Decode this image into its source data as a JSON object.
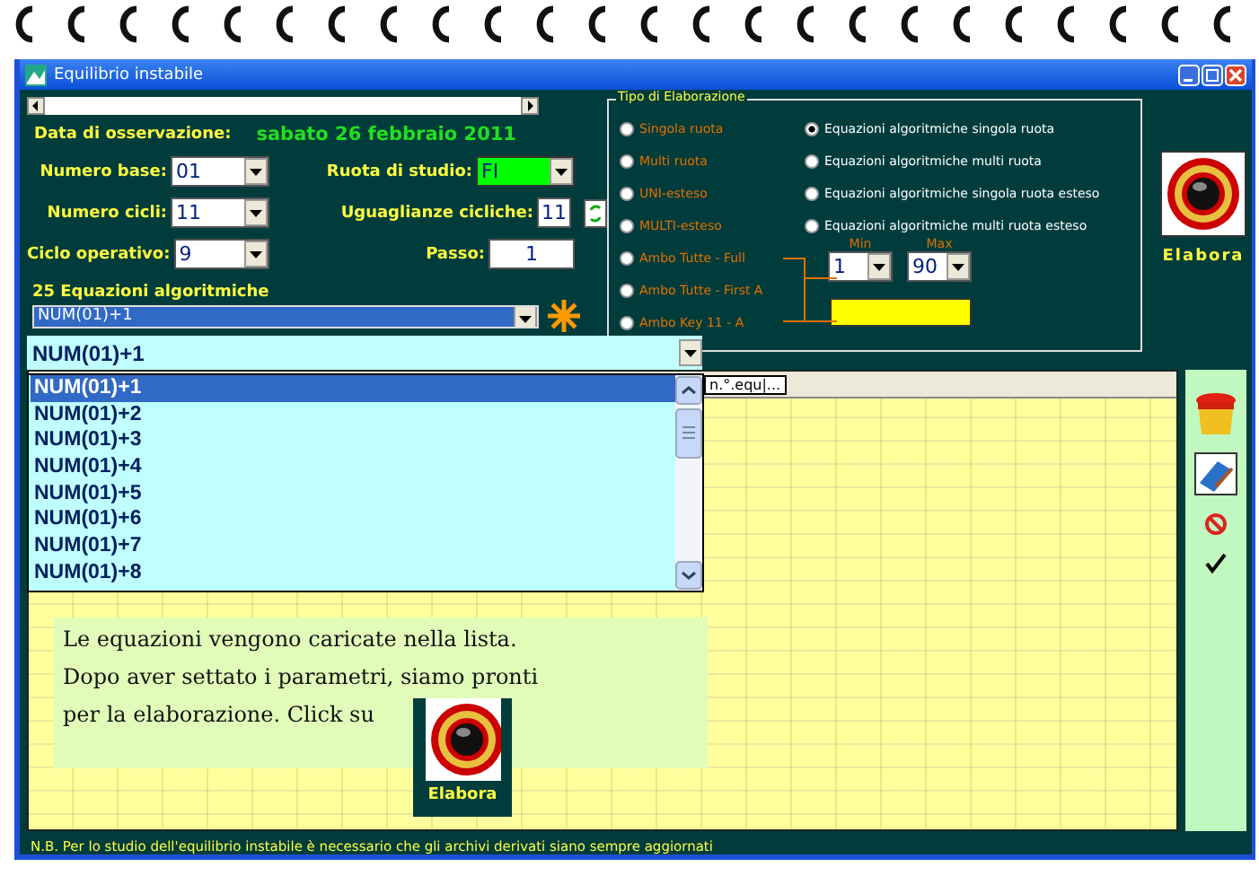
{
  "window": {
    "title": "Equilibrio instabile"
  },
  "date": {
    "label": "Data di osservazione:",
    "value": "sabato 26 febbraio 2011"
  },
  "fields": [
    {
      "label": "Numero base:",
      "value": "01",
      "kind": "combo",
      "highlight": false
    },
    {
      "label": "Ruota di studio:",
      "value": "FI",
      "kind": "combo",
      "highlight": true
    },
    {
      "label": "Numero cicli:",
      "value": "11",
      "kind": "combo",
      "highlight": false
    },
    {
      "label": "Uguaglianze cicliche:",
      "value": "11",
      "kind": "counter",
      "highlight": false
    },
    {
      "label": "Ciclo operativo:",
      "value": "9",
      "kind": "combo",
      "highlight": false
    },
    {
      "label": "Passo:",
      "value": "1",
      "kind": "text",
      "highlight": false
    }
  ],
  "equations": {
    "label": "25 Equazioni algoritmiche",
    "value": "NUM(01)+1",
    "edit_value": "NUM(01)+1",
    "options": [
      {
        "label": "NUM(01)+1",
        "selected": true
      },
      {
        "label": "NUM(01)+2",
        "selected": false
      },
      {
        "label": "NUM(01)+3",
        "selected": false
      },
      {
        "label": "NUM(01)+4",
        "selected": false
      },
      {
        "label": "NUM(01)+5",
        "selected": false
      },
      {
        "label": "NUM(01)+6",
        "selected": false
      },
      {
        "label": "NUM(01)+7",
        "selected": false
      },
      {
        "label": "NUM(01)+8",
        "selected": false
      }
    ]
  },
  "processing_type": {
    "title": "Tipo di Elaborazione",
    "left_options": [
      {
        "label": "Singola ruota",
        "selected": false
      },
      {
        "label": "Multi ruota",
        "selected": false
      },
      {
        "label": "UNI-esteso",
        "selected": false
      },
      {
        "label": "MULTI-esteso",
        "selected": false
      },
      {
        "label": "Ambo Tutte - Full",
        "selected": false
      },
      {
        "label": "Ambo Tutte - First A",
        "selected": false
      },
      {
        "label": "Ambo Key 11 -  A",
        "selected": false
      }
    ],
    "right_options": [
      {
        "label": "Equazioni algoritmiche singola ruota",
        "selected": true
      },
      {
        "label": "Equazioni algoritmiche multi ruota",
        "selected": false
      },
      {
        "label": "Equazioni algoritmiche singola ruota esteso",
        "selected": false
      },
      {
        "label": "Equazioni algoritmiche multi ruota esteso",
        "selected": false
      }
    ],
    "min": {
      "label": "Min",
      "value": "1"
    },
    "max": {
      "label": "Max",
      "value": "90"
    }
  },
  "run_button": {
    "label": "Elabora"
  },
  "grid": {
    "tooltip": "n.°.equ|..."
  },
  "tip": {
    "lines": [
      "Le equazioni vengono caricate nella lista.",
      "Dopo aver settato i parametri, siamo pronti",
      "per la elaborazione. Click su"
    ],
    "button_label": "Elabora"
  },
  "note": "N.B. Per lo studio dell'equilibrio instabile è necessario che gli archivi derivati siano sempre aggiornati"
}
